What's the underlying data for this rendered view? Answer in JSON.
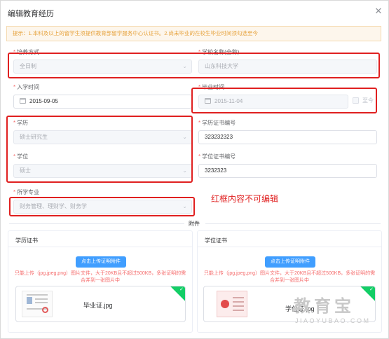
{
  "dialog": {
    "title": "编辑教育经历",
    "close_icon": "close-icon"
  },
  "tip": "提示：1.本科及以上的留学生须提供教育部留学服务中心认证书。2.尚未毕业的在校生毕业时间须勾选至今",
  "form": {
    "training_mode": {
      "label": "培养方式",
      "value": "全日制"
    },
    "school_name": {
      "label": "学校名称(全称)",
      "value": "山东科技大学"
    },
    "enrollment_date": {
      "label": "入学时间",
      "value": "2015-09-05"
    },
    "graduation_date": {
      "label": "毕业时间",
      "value": "2015-11-04",
      "until_now_label": "至今",
      "until_now_checked": false
    },
    "education": {
      "label": "学历",
      "value": "硕士研究生"
    },
    "education_cert_no": {
      "label": "学历证书编号",
      "value": "323232323"
    },
    "degree": {
      "label": "学位",
      "value": "硕士"
    },
    "degree_cert_no": {
      "label": "学位证书编号",
      "value": "3232323"
    },
    "major": {
      "label": "所学专业",
      "value": "财务管理、理财学、财务学"
    }
  },
  "annotation": "红框内容不可编辑",
  "attachments": {
    "divider_label": "附件",
    "education_card": {
      "title": "学历证书",
      "upload_label": "点击上传证明附件",
      "hint_line1": "只能上传（jpg,jpeg,png）图片文件，大于20KB且不超过500KB，多张证明的需",
      "hint_line2": "合并到一张图片中",
      "file_name": "毕业证.jpg"
    },
    "degree_card": {
      "title": "学位证书",
      "upload_label": "点击上传证明附件",
      "hint_line1": "只能上传（jpg,jpeg,png）图片文件，大于20KB且不超过500KB，多张证明的需",
      "hint_line2": "合并到一张图片中",
      "file_name": "学位证.jpg"
    }
  },
  "watermark": {
    "text": "教育宝",
    "sub": "JIAOYUBAO.COM"
  },
  "colors": {
    "accent": "#409eff",
    "required_star": "#f56c6c",
    "annotation_red": "#e02020",
    "tip_bg": "#fdf6ec",
    "tip_text": "#e6a23c",
    "success_corner": "#13ce66"
  }
}
